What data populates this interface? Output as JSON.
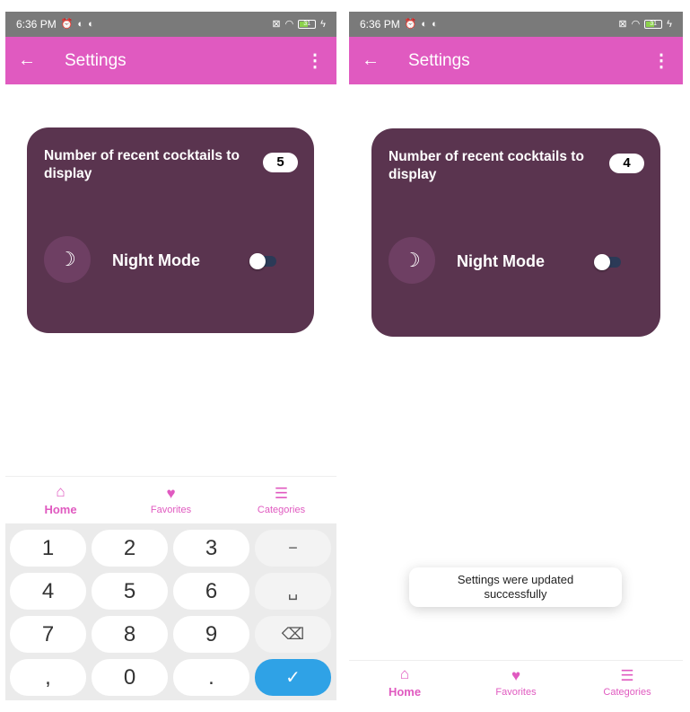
{
  "status": {
    "time": "6:36 PM",
    "battery": "31"
  },
  "appbar": {
    "back_icon": "←",
    "title": "Settings",
    "more_icon": "⋮"
  },
  "settings": {
    "recent_label": "Number of recent cocktails to display",
    "left_value": "5",
    "right_value": "4",
    "night_mode_label": "Night Mode",
    "night_mode_on": false
  },
  "nav": {
    "home": "Home",
    "favorites": "Favorites",
    "categories": "Categories"
  },
  "keyboard": {
    "keys": [
      "1",
      "2",
      "3",
      "−",
      "4",
      "5",
      "6",
      "␣",
      "7",
      "8",
      "9",
      "⌫",
      ",",
      "0",
      ".",
      "✓"
    ]
  },
  "toast": {
    "message": "Settings were updated successfully"
  },
  "colors": {
    "accent": "#e05ac0",
    "card": "#5a344f",
    "statusbar": "#7a7a7a",
    "keyboard_done": "#2fa2e6"
  }
}
